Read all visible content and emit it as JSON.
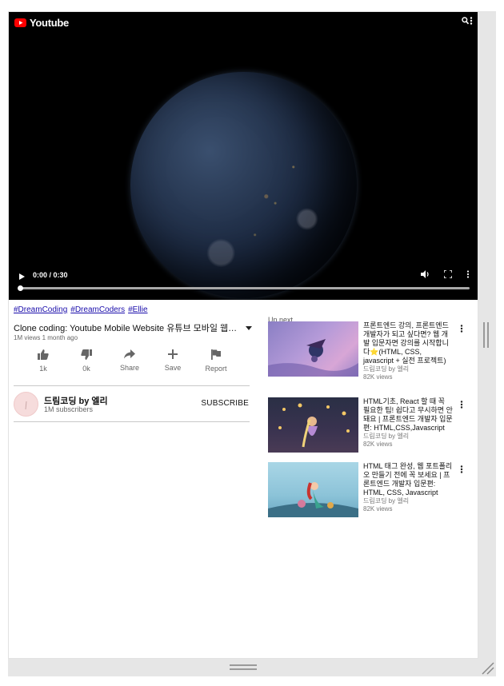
{
  "player": {
    "brand": "Youtube",
    "time": "0:00 / 0:30",
    "progress": 0.0
  },
  "video": {
    "hashtags": [
      "#DreamCoding",
      "#DreamCoders",
      "#Ellie"
    ],
    "title": "Clone coding: Youtube Mobile Website 유튜브 모바일 웹사이트 클론 코딩",
    "meta": "1M views 1 month ago"
  },
  "actions": [
    {
      "label": "1k",
      "icon": "thumbs-up-icon"
    },
    {
      "label": "0k",
      "icon": "thumbs-down-icon"
    },
    {
      "label": "Share",
      "icon": "share-icon"
    },
    {
      "label": "Save",
      "icon": "plus-icon"
    },
    {
      "label": "Report",
      "icon": "flag-icon"
    }
  ],
  "channel": {
    "name": "드림코딩 by 엘리",
    "subscribers": "1M subscribers",
    "subscribe_label": "SUBSCRIBE"
  },
  "upnext": {
    "label": "Up next",
    "items": [
      {
        "title": "프론트엔드 강의, 프론트엔드 개발자가 되고 싶다면? 웹 개발 입문자면 강의를 시작합니다⭐(HTML, CSS, javascript + 실전 프로젝트)",
        "channel": "드림코딩 by 엘리",
        "views": "82K views"
      },
      {
        "title": "HTML기초, React 할 때 꼭 필요한 팁! 쉽다고 무시하면 안돼요 | 프론트엔드 개발자 입문편: HTML,CSS,Javascript",
        "channel": "드림코딩 by 엘리",
        "views": "82K views"
      },
      {
        "title": "HTML 태그 완성, 웹 포트폴리오 만들기 전에 꼭 보세요 | 프론트엔드 개발자 입문편: HTML, CSS, Javascript",
        "channel": "드림코딩 by 엘리",
        "views": "82K views"
      }
    ]
  },
  "colors": {
    "brand_red": "#ff0000",
    "link": "#1a0dab"
  }
}
